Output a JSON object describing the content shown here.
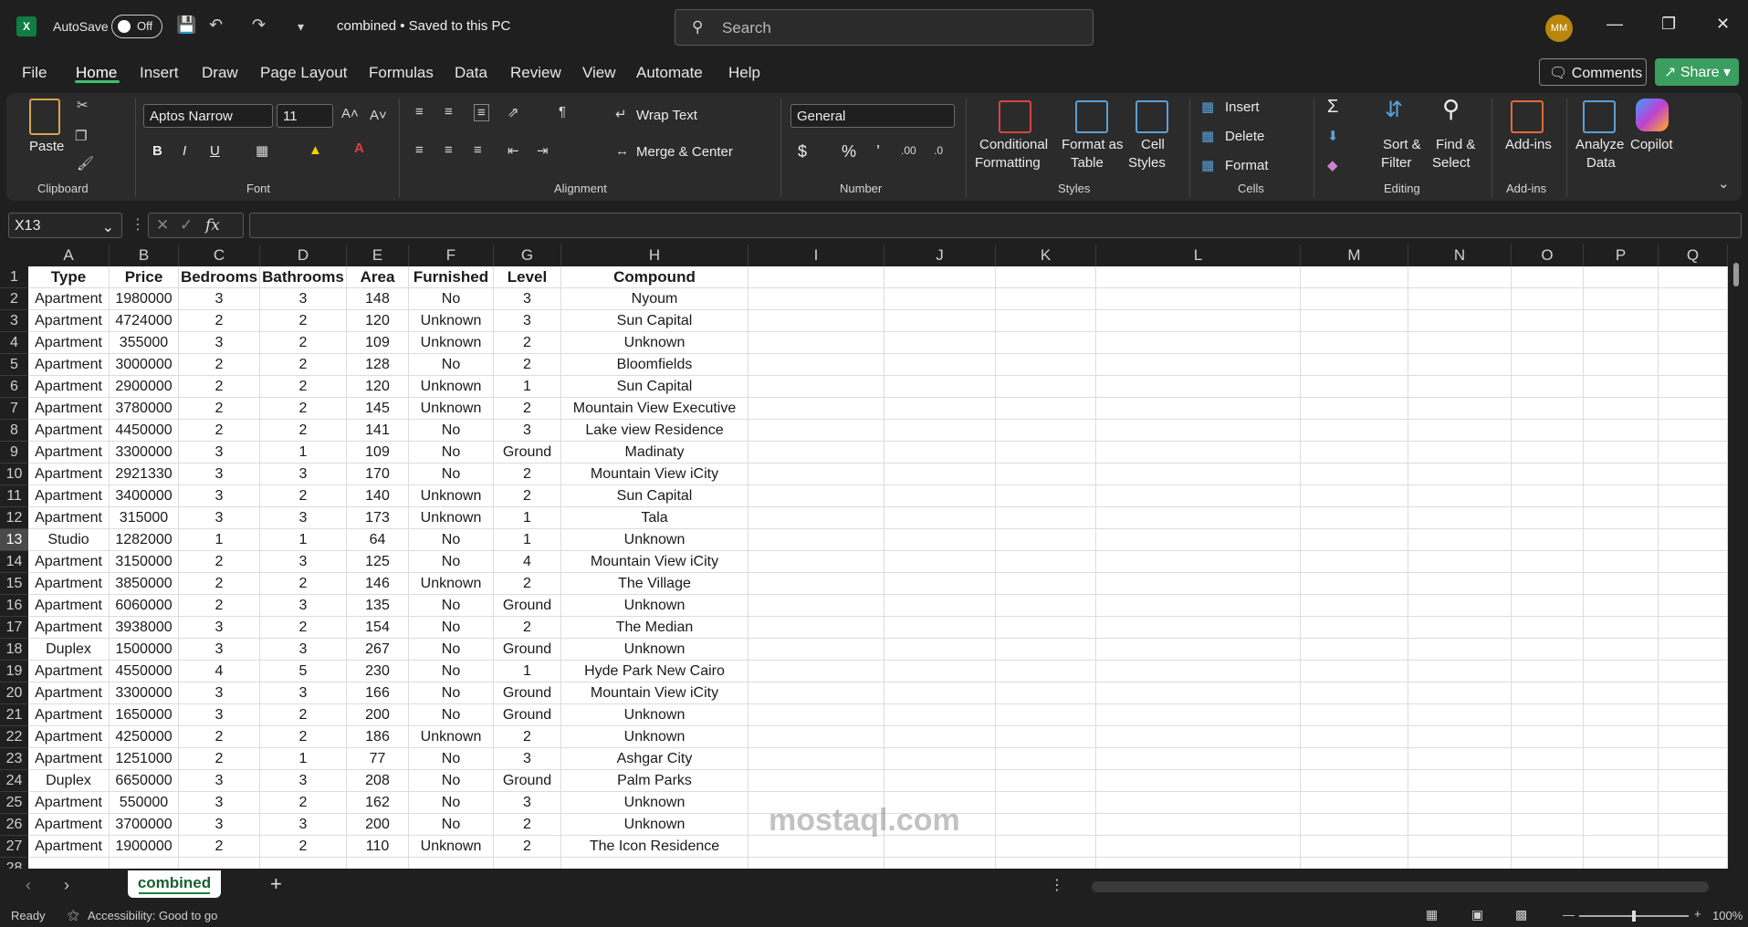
{
  "titlebar": {
    "app_icon": "excel-icon",
    "autosave_label": "AutoSave",
    "autosave_state": "Off",
    "doc_title": "combined • Saved to this PC",
    "search_placeholder": "Search",
    "avatar_initials": "MM"
  },
  "menu": {
    "tabs": [
      "File",
      "Home",
      "Insert",
      "Draw",
      "Page Layout",
      "Formulas",
      "Data",
      "Review",
      "View",
      "Automate",
      "Help"
    ],
    "active_tab": "Home",
    "comments_label": "Comments",
    "share_label": "Share"
  },
  "ribbon": {
    "clipboard": {
      "paste": "Paste",
      "label": "Clipboard"
    },
    "font": {
      "family": "Aptos Narrow",
      "size": "11",
      "bold": "B",
      "italic": "I",
      "underline": "U",
      "label": "Font"
    },
    "alignment": {
      "wrap_text": "Wrap Text",
      "merge_center": "Merge & Center",
      "label": "Alignment"
    },
    "number": {
      "format": "General",
      "label": "Number"
    },
    "styles": {
      "conditional_1": "Conditional",
      "conditional_2": "Formatting",
      "format_table_1": "Format as",
      "format_table_2": "Table",
      "cell_styles_1": "Cell",
      "cell_styles_2": "Styles",
      "label": "Styles"
    },
    "cells": {
      "insert": "Insert",
      "delete": "Delete",
      "format": "Format",
      "label": "Cells"
    },
    "editing": {
      "sort_1": "Sort &",
      "sort_2": "Filter",
      "find_1": "Find &",
      "find_2": "Select",
      "label": "Editing"
    },
    "addins": {
      "addins": "Add-ins",
      "label": "Add-ins"
    },
    "analyze_1": "Analyze",
    "analyze_2": "Data",
    "copilot": "Copilot"
  },
  "formula_bar": {
    "name_box": "X13",
    "fx": "fx",
    "content": ""
  },
  "grid": {
    "columns": [
      "A",
      "B",
      "C",
      "D",
      "E",
      "F",
      "G",
      "H",
      "I",
      "J",
      "K",
      "L",
      "M",
      "N",
      "O",
      "P",
      "Q"
    ],
    "selected_row": "13",
    "rows": [
      [
        "Type",
        "Price",
        "Bedrooms",
        "Bathrooms",
        "Area",
        "Furnished",
        "Level",
        "Compound"
      ],
      [
        "Apartment",
        "1980000",
        "3",
        "3",
        "148",
        "No",
        "3",
        "Nyoum"
      ],
      [
        "Apartment",
        "4724000",
        "2",
        "2",
        "120",
        "Unknown",
        "3",
        "Sun Capital"
      ],
      [
        "Apartment",
        "355000",
        "3",
        "2",
        "109",
        "Unknown",
        "2",
        "Unknown"
      ],
      [
        "Apartment",
        "3000000",
        "2",
        "2",
        "128",
        "No",
        "2",
        "Bloomfields"
      ],
      [
        "Apartment",
        "2900000",
        "2",
        "2",
        "120",
        "Unknown",
        "1",
        "Sun Capital"
      ],
      [
        "Apartment",
        "3780000",
        "2",
        "2",
        "145",
        "Unknown",
        "2",
        "Mountain View Executive"
      ],
      [
        "Apartment",
        "4450000",
        "2",
        "2",
        "141",
        "No",
        "3",
        "Lake view Residence"
      ],
      [
        "Apartment",
        "3300000",
        "3",
        "1",
        "109",
        "No",
        "Ground",
        "Madinaty"
      ],
      [
        "Apartment",
        "2921330",
        "3",
        "3",
        "170",
        "No",
        "2",
        "Mountain View iCity"
      ],
      [
        "Apartment",
        "3400000",
        "3",
        "2",
        "140",
        "Unknown",
        "2",
        "Sun Capital"
      ],
      [
        "Apartment",
        "315000",
        "3",
        "3",
        "173",
        "Unknown",
        "1",
        "Tala"
      ],
      [
        "Studio",
        "1282000",
        "1",
        "1",
        "64",
        "No",
        "1",
        "Unknown"
      ],
      [
        "Apartment",
        "3150000",
        "2",
        "3",
        "125",
        "No",
        "4",
        "Mountain View iCity"
      ],
      [
        "Apartment",
        "3850000",
        "2",
        "2",
        "146",
        "Unknown",
        "2",
        "The Village"
      ],
      [
        "Apartment",
        "6060000",
        "2",
        "3",
        "135",
        "No",
        "Ground",
        "Unknown"
      ],
      [
        "Apartment",
        "3938000",
        "3",
        "2",
        "154",
        "No",
        "2",
        "The Median"
      ],
      [
        "Duplex",
        "1500000",
        "3",
        "3",
        "267",
        "No",
        "Ground",
        "Unknown"
      ],
      [
        "Apartment",
        "4550000",
        "4",
        "5",
        "230",
        "No",
        "1",
        "Hyde Park New Cairo"
      ],
      [
        "Apartment",
        "3300000",
        "3",
        "3",
        "166",
        "No",
        "Ground",
        "Mountain View iCity"
      ],
      [
        "Apartment",
        "1650000",
        "3",
        "2",
        "200",
        "No",
        "Ground",
        "Unknown"
      ],
      [
        "Apartment",
        "4250000",
        "2",
        "2",
        "186",
        "Unknown",
        "2",
        "Unknown"
      ],
      [
        "Apartment",
        "1251000",
        "2",
        "1",
        "77",
        "No",
        "3",
        "Ashgar City"
      ],
      [
        "Duplex",
        "6650000",
        "3",
        "3",
        "208",
        "No",
        "Ground",
        "Palm Parks"
      ],
      [
        "Apartment",
        "550000",
        "3",
        "2",
        "162",
        "No",
        "3",
        "Unknown"
      ],
      [
        "Apartment",
        "3700000",
        "3",
        "3",
        "200",
        "No",
        "2",
        "Unknown"
      ],
      [
        "Apartment",
        "1900000",
        "2",
        "2",
        "110",
        "Unknown",
        "2",
        "The Icon Residence"
      ]
    ]
  },
  "sheets": {
    "active": "combined",
    "add_label": "+"
  },
  "status": {
    "ready": "Ready",
    "accessibility": "Accessibility: Good to go",
    "zoom": "100%"
  },
  "watermark": "mostaql.com"
}
